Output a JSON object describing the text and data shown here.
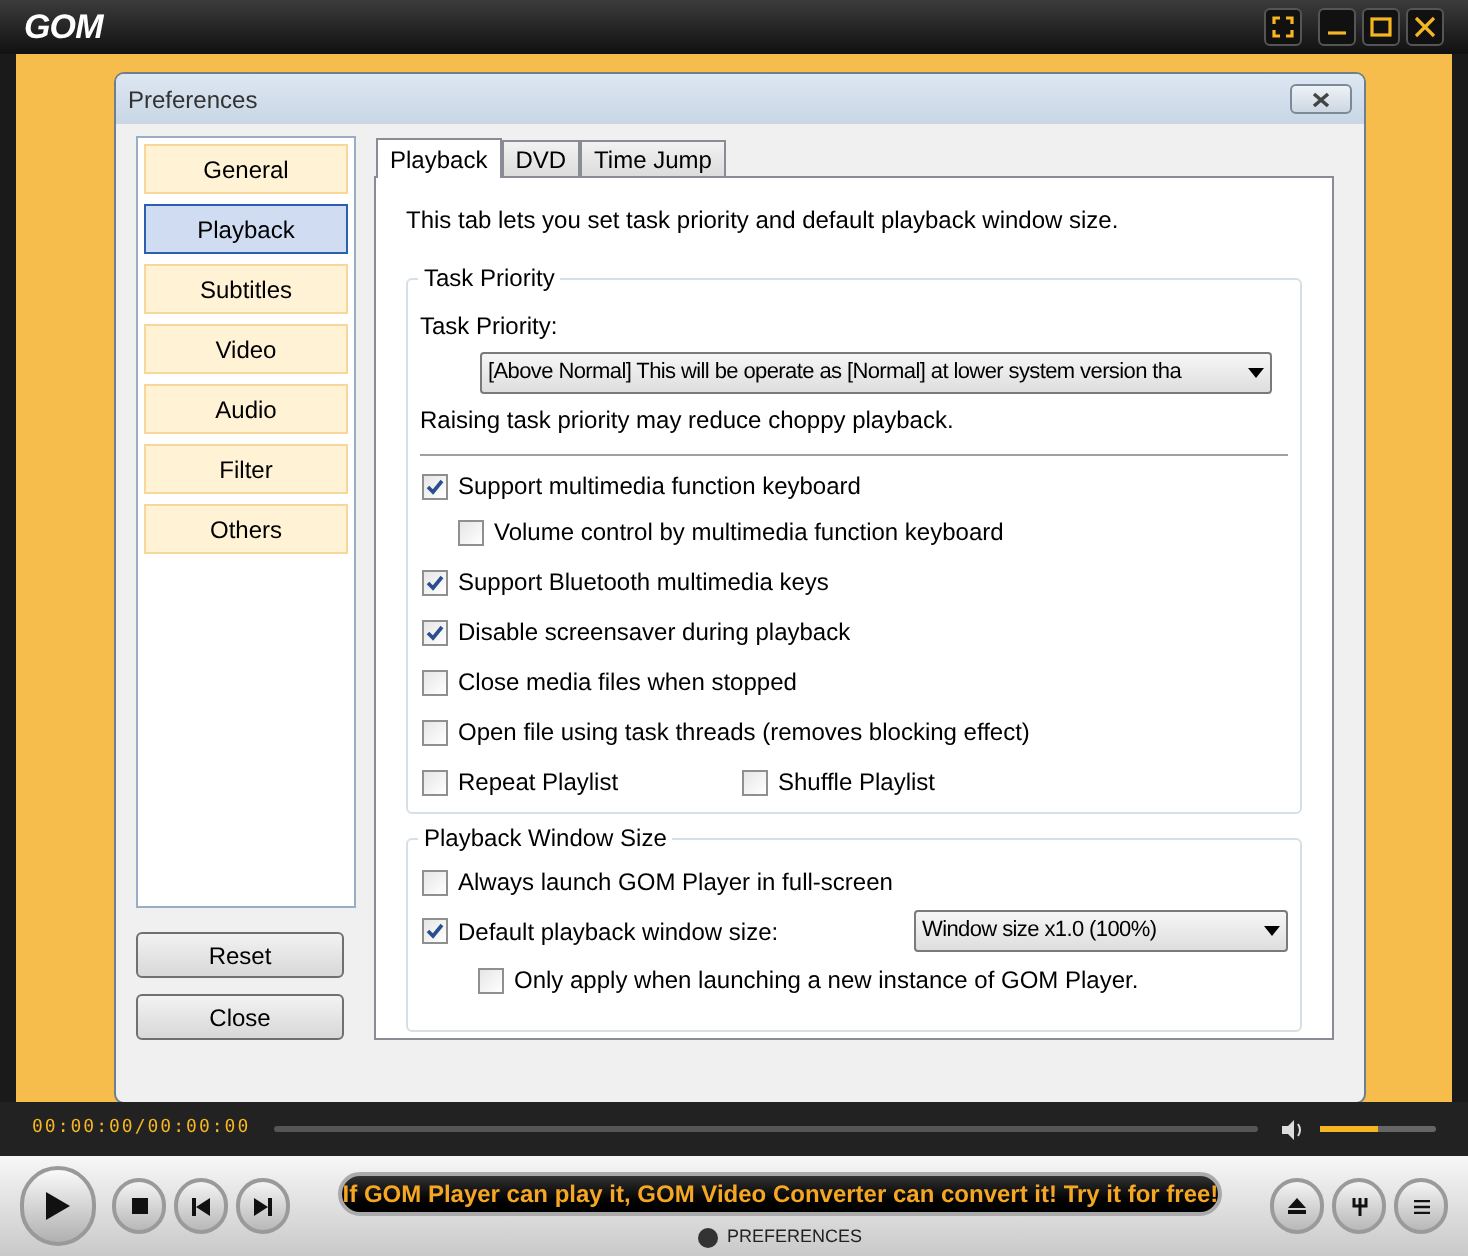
{
  "app": {
    "logo": "GOM"
  },
  "dialog": {
    "title": "Preferences"
  },
  "categories": [
    {
      "label": "General",
      "selected": false
    },
    {
      "label": "Playback",
      "selected": true
    },
    {
      "label": "Subtitles",
      "selected": false
    },
    {
      "label": "Video",
      "selected": false
    },
    {
      "label": "Audio",
      "selected": false
    },
    {
      "label": "Filter",
      "selected": false
    },
    {
      "label": "Others",
      "selected": false
    }
  ],
  "buttons": [
    "Reset",
    "Close"
  ],
  "tabs": [
    {
      "label": "Playback",
      "selected": true
    },
    {
      "label": "DVD",
      "selected": false
    },
    {
      "label": "Time Jump",
      "selected": false
    }
  ],
  "description": "This tab lets you set task priority and default playback window size.",
  "task_priority": {
    "legend": "Task Priority",
    "label": "Task Priority:",
    "value": "[Above Normal] This will be operate as [Normal] at lower system version tha",
    "note": "Raising task priority may reduce choppy playback."
  },
  "option_rows": [
    [
      {
        "label": "Support multimedia function keyboard",
        "checked": true,
        "children": [
          {
            "label": "Volume control by multimedia function keyboard",
            "checked": false
          }
        ]
      }
    ],
    [
      {
        "label": "Support Bluetooth multimedia keys",
        "checked": true
      }
    ],
    [
      {
        "label": "Disable screensaver during playback",
        "checked": true
      }
    ],
    [
      {
        "label": "Close media files when stopped",
        "checked": false
      }
    ],
    [
      {
        "label": "Open file using task threads (removes blocking effect)",
        "checked": false
      }
    ],
    [
      {
        "label": "Repeat Playlist",
        "checked": false
      },
      {
        "label": "Shuffle Playlist",
        "checked": false
      }
    ]
  ],
  "window_size": {
    "legend": "Playback Window Size",
    "options": [
      {
        "label": "Always launch GOM Player in full-screen",
        "checked": false
      },
      {
        "label": "Default playback window size:",
        "checked": true,
        "select": "Window size x1.0 (100%)",
        "children": [
          {
            "label": "Only apply when launching a new instance of GOM Player.",
            "checked": false
          }
        ]
      }
    ]
  },
  "player": {
    "time": "00:00:00/00:00:00",
    "volume": {
      "level": 0.5
    },
    "ticker": "If GOM Player can play it, GOM Video Converter can convert it! Try it for free!",
    "status": "PREFERENCES"
  }
}
